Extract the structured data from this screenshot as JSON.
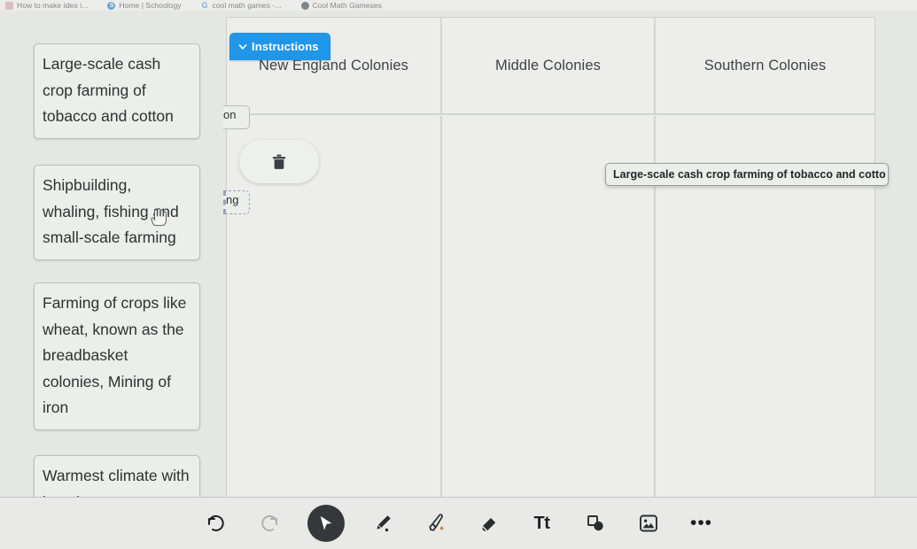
{
  "browser": {
    "bookmarks": [
      {
        "label": "How to make idea i...",
        "icon": "folder-icon",
        "kind": "pink"
      },
      {
        "label": "Home | Schoology",
        "icon": "schoology-icon",
        "kind": "blue"
      },
      {
        "label": "cool math games -...",
        "icon": "google-icon",
        "kind": "g"
      },
      {
        "label": "Cool Math Gameses",
        "icon": "search-icon",
        "kind": "mag"
      }
    ]
  },
  "activity": {
    "instructions_button": {
      "label": "Instructions",
      "icon": "chevron-down-icon",
      "color": "#1f96e8"
    },
    "columns": [
      {
        "title": "New England Colonies"
      },
      {
        "title": "Middle Colonies"
      },
      {
        "title": "Southern Colonies"
      }
    ],
    "answer_bank": [
      {
        "text": "Large-scale cash crop farming of tobacco and cotton"
      },
      {
        "text": "Shipbuilding, whaling, fishing and small-scale farming"
      },
      {
        "text": "Farming of crops like wheat, known as the breadbasket colonies, Mining of iron"
      },
      {
        "text": "Warmest climate with long hot"
      }
    ],
    "tile_edges": [
      {
        "text": "on"
      },
      {
        "text": "ng"
      }
    ],
    "dragged_tile": {
      "text": "Large-scale cash crop farming of tobacco and cotto"
    },
    "trash_button": {
      "icon": "trash-icon",
      "label": ""
    }
  },
  "toolbar": {
    "items": [
      {
        "name": "undo-button",
        "icon": "undo-icon",
        "label": ""
      },
      {
        "name": "redo-button",
        "icon": "redo-icon",
        "label": ""
      },
      {
        "name": "select-tool",
        "icon": "cursor-arrow-icon",
        "label": "",
        "active": true
      },
      {
        "name": "pen-tool",
        "icon": "pen-icon",
        "label": ""
      },
      {
        "name": "highlighter-tool",
        "icon": "highlighter-icon",
        "label": ""
      },
      {
        "name": "eraser-tool",
        "icon": "eraser-icon",
        "label": ""
      },
      {
        "name": "text-tool",
        "icon": "text-icon",
        "label": "Tt"
      },
      {
        "name": "shapes-tool",
        "icon": "shapes-icon",
        "label": ""
      },
      {
        "name": "image-tool",
        "icon": "image-icon",
        "label": ""
      },
      {
        "name": "more-tools-button",
        "icon": "more-horizontal-icon",
        "label": "•••"
      }
    ]
  },
  "cursors": {
    "hand": "pointing-hand-cursor",
    "arrow": "arrow-cursor"
  }
}
